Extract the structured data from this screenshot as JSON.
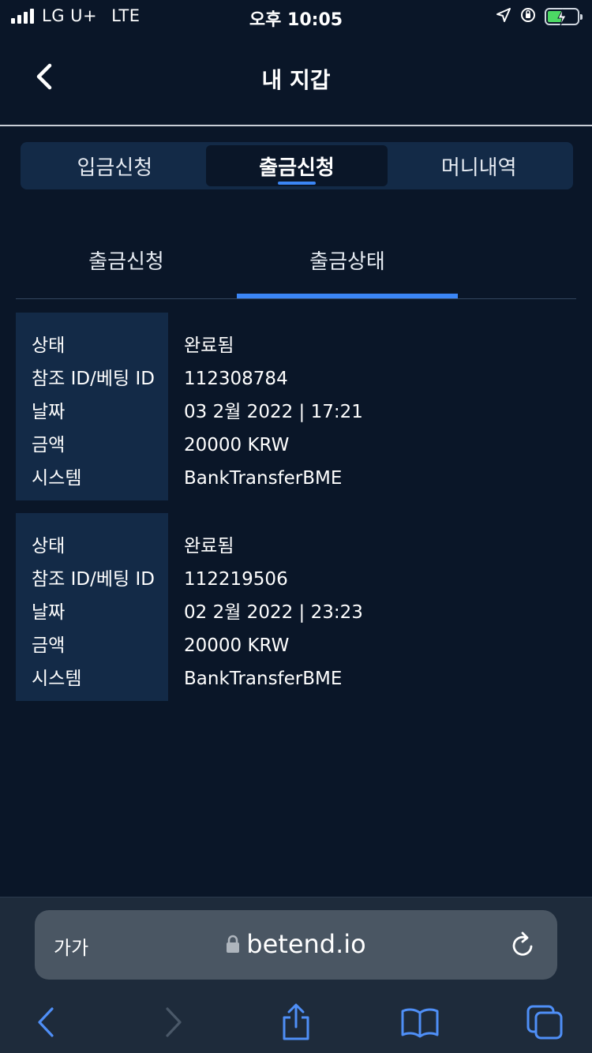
{
  "status_bar": {
    "carrier": "LG U+",
    "network": "LTE",
    "time": "오후 10:05"
  },
  "header": {
    "title": "내 지갑"
  },
  "main_tabs": [
    {
      "label": "입금신청",
      "active": false
    },
    {
      "label": "출금신청",
      "active": true
    },
    {
      "label": "머니내역",
      "active": false
    }
  ],
  "sub_tabs": [
    {
      "label": "출금신청",
      "active": false
    },
    {
      "label": "출금상태",
      "active": true
    }
  ],
  "labels": {
    "status": "상태",
    "ref_id": "참조 ID/베팅 ID",
    "date": "날짜",
    "amount": "금액",
    "system": "시스템"
  },
  "records": [
    {
      "status": "완료됨",
      "ref_id": "112308784",
      "date": "03 2월 2022 | 17:21",
      "amount": "20000 KRW",
      "system": "BankTransferBME"
    },
    {
      "status": "완료됨",
      "ref_id": "112219506",
      "date": "02 2월 2022 | 23:23",
      "amount": "20000 KRW",
      "system": "BankTransferBME"
    }
  ],
  "browser": {
    "text_size_label": "가가",
    "url": "betend.io"
  },
  "colors": {
    "background": "#0a1628",
    "panel": "#132a47",
    "accent": "#3b86f6",
    "browser_bar": "#1e2b3b",
    "url_field": "#4a5663",
    "toolbar_icon": "#4f8ff7"
  },
  "icons": [
    "back-chevron-icon",
    "location-arrow-icon",
    "orientation-lock-icon",
    "battery-charging-icon",
    "lock-icon",
    "reload-icon",
    "back-icon",
    "forward-icon",
    "share-icon",
    "bookmarks-icon",
    "tabs-icon"
  ]
}
